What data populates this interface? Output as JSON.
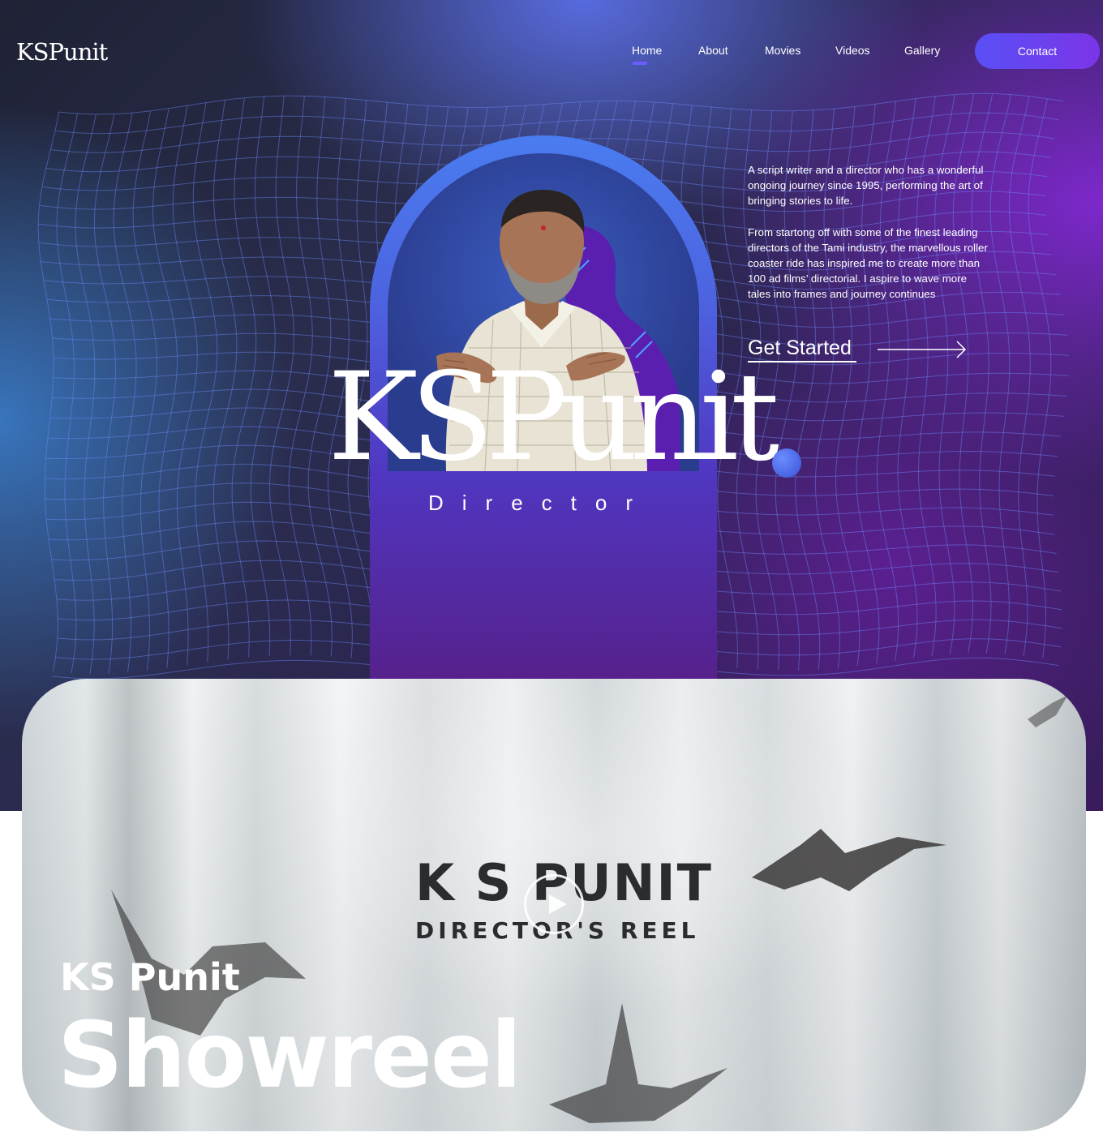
{
  "header": {
    "logo_text": "KSPunit",
    "nav": [
      {
        "label": "Home"
      },
      {
        "label": "About"
      },
      {
        "label": "Movies"
      },
      {
        "label": "Videos"
      },
      {
        "label": "Gallery"
      }
    ],
    "active_nav": "Home",
    "contact_label": "Contact"
  },
  "hero": {
    "title": "KSPunit",
    "subtitle": "Director",
    "bio": [
      "A script writer and a director who has a wonderful ongoing journey since 1995, performing the art of bringing stories to life.",
      "From startong off with some of the finest leading directors of the Tami industry, the marvellous roller coaster ride has inspired me to create more than 100 ad films’ directorial. I aspire to wave more tales into frames and journey continues"
    ],
    "cta_label": "Get Started"
  },
  "showreel": {
    "video_title": "K S PUNIT",
    "video_subtitle": "DIRECTOR'S REEL",
    "kicker": "KS Punit",
    "title": "Showreel"
  },
  "colors": {
    "accent": "#6b5cff",
    "contact_gradient_start": "#5a4ff5",
    "contact_gradient_end": "#7a35e8",
    "arch_top": "#4a7cf0",
    "arch_bottom": "#56208a"
  },
  "icons": {
    "cta": "arrow-right-icon",
    "play": "play-icon"
  }
}
